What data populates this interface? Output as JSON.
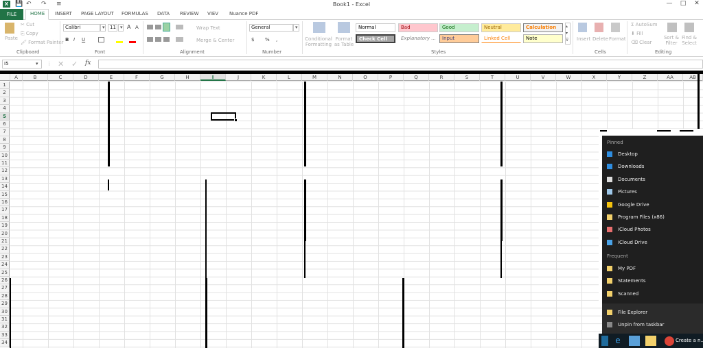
{
  "window": {
    "title": "Book1 - Excel",
    "logo": "X",
    "min": "—",
    "max": "□",
    "close": "✕"
  },
  "qat": {
    "save": "💾",
    "undo": "↶",
    "redo": "↷",
    "more": "≡"
  },
  "tabs": [
    "FILE",
    "HOME",
    "INSERT",
    "PAGE LAYOUT",
    "FORMULAS",
    "DATA",
    "REVIEW",
    "VIEV",
    "Nuance PDF"
  ],
  "clipboard": {
    "paste": "Paste",
    "cut": "Cut",
    "copy": "Copy",
    "format_painter": "Format Painter",
    "label": "Clipboard"
  },
  "font": {
    "name": "Calibri",
    "size": "11",
    "bold": "B",
    "italic": "I",
    "underline": "U",
    "grow": "A",
    "shrink": "A",
    "label": "Font"
  },
  "alignment": {
    "wrap": "Wrap Text",
    "merge": "Merge & Center",
    "label": "Alignment"
  },
  "number": {
    "format": "General",
    "currency": "$",
    "percent": "%",
    "comma": ",",
    "label": "Number"
  },
  "styles": {
    "conditional": "Conditional Formatting",
    "format_table": "Format as Table",
    "cells": [
      "Normal",
      "Bad",
      "Good",
      "Neutral",
      "Calculation",
      "Check Cell",
      "Explanatory ...",
      "Input",
      "Linked Cell",
      "Note"
    ],
    "label": "Styles"
  },
  "cells_group": {
    "insert": "Insert",
    "delete": "Delete",
    "format": "Format",
    "label": "Cells"
  },
  "editing": {
    "autosum": "AutoSum",
    "fill": "Fill",
    "clear": "Clear",
    "sort": "Sort & Filter",
    "find": "Find & Select",
    "label": "Editing"
  },
  "formula_bar": {
    "name_box": "I5",
    "cancel": "✕",
    "enter": "✓",
    "fx": "fx",
    "value": ""
  },
  "columns": [
    "A",
    "B",
    "C",
    "D",
    "E",
    "F",
    "G",
    "H",
    "I",
    "J",
    "K",
    "L",
    "M",
    "N",
    "O",
    "P",
    "Q",
    "R",
    "S",
    "T",
    "U",
    "V",
    "W",
    "X",
    "Y",
    "Z",
    "AA",
    "AB"
  ],
  "selected_column": "I",
  "rows": [
    "1",
    "2",
    "3",
    "4",
    "5",
    "6",
    "7",
    "8",
    "9",
    "10",
    "11",
    "12",
    "13",
    "14",
    "15",
    "16",
    "17",
    "18",
    "19",
    "20",
    "21",
    "22",
    "23",
    "24",
    "25",
    "26",
    "27",
    "28",
    "29",
    "30",
    "31",
    "32",
    "33",
    "34"
  ],
  "selected_row": "5",
  "jumplist": {
    "pinned_label": "Pinned",
    "pinned": [
      {
        "label": "Desktop",
        "icon": "desktop-icon",
        "color": "#2e8de0"
      },
      {
        "label": "Downloads",
        "icon": "download-icon",
        "color": "#2e8de0"
      },
      {
        "label": "Documents",
        "icon": "document-icon",
        "color": "#dddddd"
      },
      {
        "label": "Pictures",
        "icon": "pictures-icon",
        "color": "#9ec7e8"
      },
      {
        "label": "Google Drive",
        "icon": "google-drive-icon",
        "color": "#f4c20d"
      },
      {
        "label": "Program Files (x86)",
        "icon": "folder-icon",
        "color": "#f2d06b"
      },
      {
        "label": "iCloud Photos",
        "icon": "icloud-photos-icon",
        "color": "#e86f6f"
      },
      {
        "label": "iCloud Drive",
        "icon": "icloud-drive-icon",
        "color": "#4aa3e8"
      }
    ],
    "frequent_label": "Frequent",
    "frequent": [
      {
        "label": "My PDF",
        "icon": "folder-icon",
        "color": "#f2d06b"
      },
      {
        "label": "Statements",
        "icon": "folder-icon",
        "color": "#f2d06b"
      },
      {
        "label": "Scanned",
        "icon": "folder-icon",
        "color": "#f2d06b"
      }
    ],
    "file_explorer": "File Explorer",
    "unpin": "Unpin from taskbar"
  },
  "taskbar": {
    "chrome_label": "Create a n..."
  },
  "colors": {
    "excel_green": "#217346",
    "bad_bg": "#ffc7ce",
    "good_bg": "#c6efce",
    "neutral_bg": "#ffeb9c",
    "check_bg": "#a5a5a5",
    "input_bg": "#ffcc99",
    "note_bg": "#ffffcc"
  }
}
